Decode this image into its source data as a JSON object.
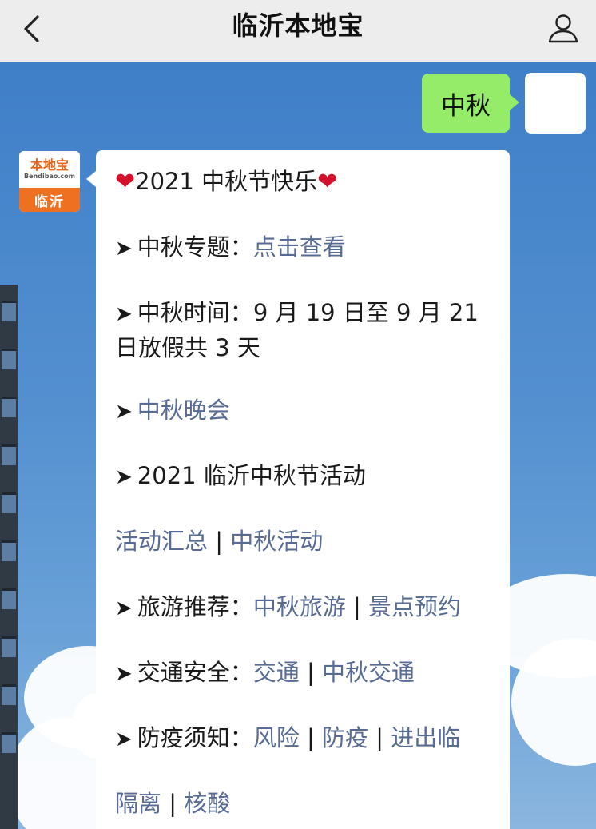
{
  "header": {
    "title": "临沂本地宝"
  },
  "user_message": {
    "text": "中秋"
  },
  "bot": {
    "avatar_logo": "本地宝",
    "avatar_sub": "Bendibao.com",
    "avatar_city": "临沂"
  },
  "message": {
    "greeting_heart_left": "❤",
    "greeting_text": "2021 中秋节快乐",
    "greeting_heart_right": "❤",
    "arrow": "➤",
    "topic_label": "中秋专题：",
    "topic_link": "点击查看",
    "time_label": "中秋时间：",
    "time_value": "9 月 19 日至 9 月 21 日放假共 3 天",
    "gala_link": "中秋晚会",
    "activities_title": "2021 临沂中秋节活动",
    "activities_link_1": "活动汇总",
    "activities_link_2": "中秋活动",
    "travel_label": "旅游推荐：",
    "travel_link_1": "中秋旅游",
    "travel_link_2": "景点预约",
    "traffic_label": "交通安全：",
    "traffic_link_1": "交通",
    "traffic_link_2": "中秋交通",
    "epidemic_label": "防疫须知：",
    "epidemic_link_1": "风险",
    "epidemic_link_2": "防疫",
    "epidemic_link_3": "进出临",
    "epidemic_link_4": "隔离",
    "epidemic_link_5": "核酸",
    "separator": "|"
  },
  "colors": {
    "header_bg": "#ededed",
    "user_bubble": "#95ec69",
    "link": "#576b95",
    "brand_orange": "#f07022",
    "heart": "#d4102a"
  },
  "icons": {
    "back": "chevron-left-icon",
    "profile": "person-icon"
  }
}
